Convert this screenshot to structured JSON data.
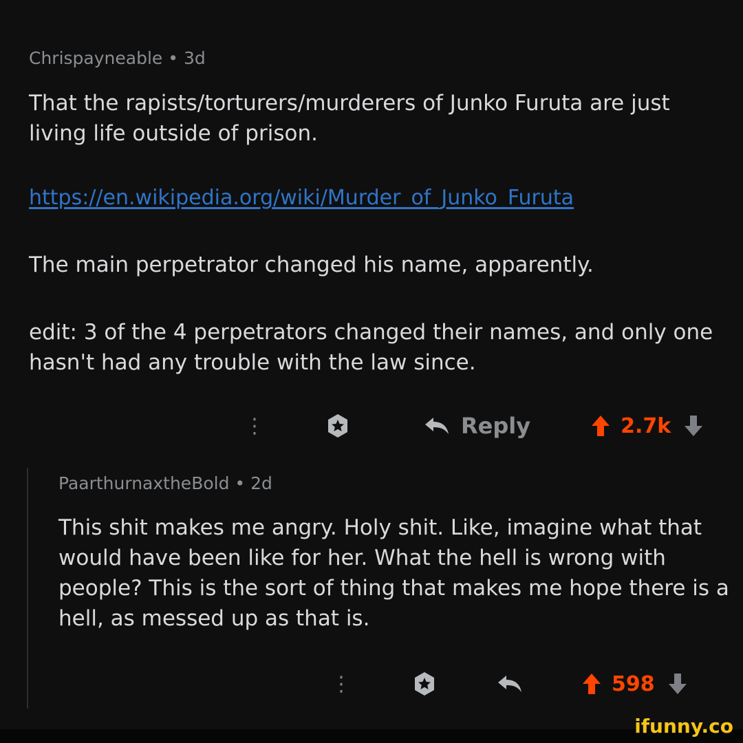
{
  "comments": [
    {
      "author": "Chrispayneable",
      "age": "3d",
      "paragraphs": [
        "That the rapists/torturers/murderers of Junko Furuta are just living life outside of prison.",
        "The main perpetrator changed his name, apparently.",
        "edit: 3 of the 4 perpetrators changed their names, and only one hasn't had any trouble with the law since."
      ],
      "link": "https://en.wikipedia.org/wiki/Murder_of_Junko_Furuta",
      "reply_label": "Reply",
      "score": "2.7k"
    },
    {
      "author": "PaarthurnaxtheBold",
      "age": "2d",
      "paragraphs": [
        "This shit makes me angry. Holy shit. Like, imagine what that would have been like for her. What the hell is wrong with people? This is the sort of thing that makes me hope there is a hell, as messed up as that is."
      ],
      "score": "598"
    }
  ],
  "separator": "•",
  "more_icon_glyph": "⋮",
  "watermark": "ifunny.co",
  "colors": {
    "background": "#0f0f10",
    "text": "#d9dadc",
    "meta": "#8b8e91",
    "link": "#2f75c8",
    "upvote": "#ff4500",
    "downvote": "#7d8084",
    "watermark": "#f5c518"
  },
  "icons": [
    "more-options-icon",
    "award-icon",
    "reply-icon",
    "upvote-arrow-icon",
    "downvote-arrow-icon"
  ]
}
